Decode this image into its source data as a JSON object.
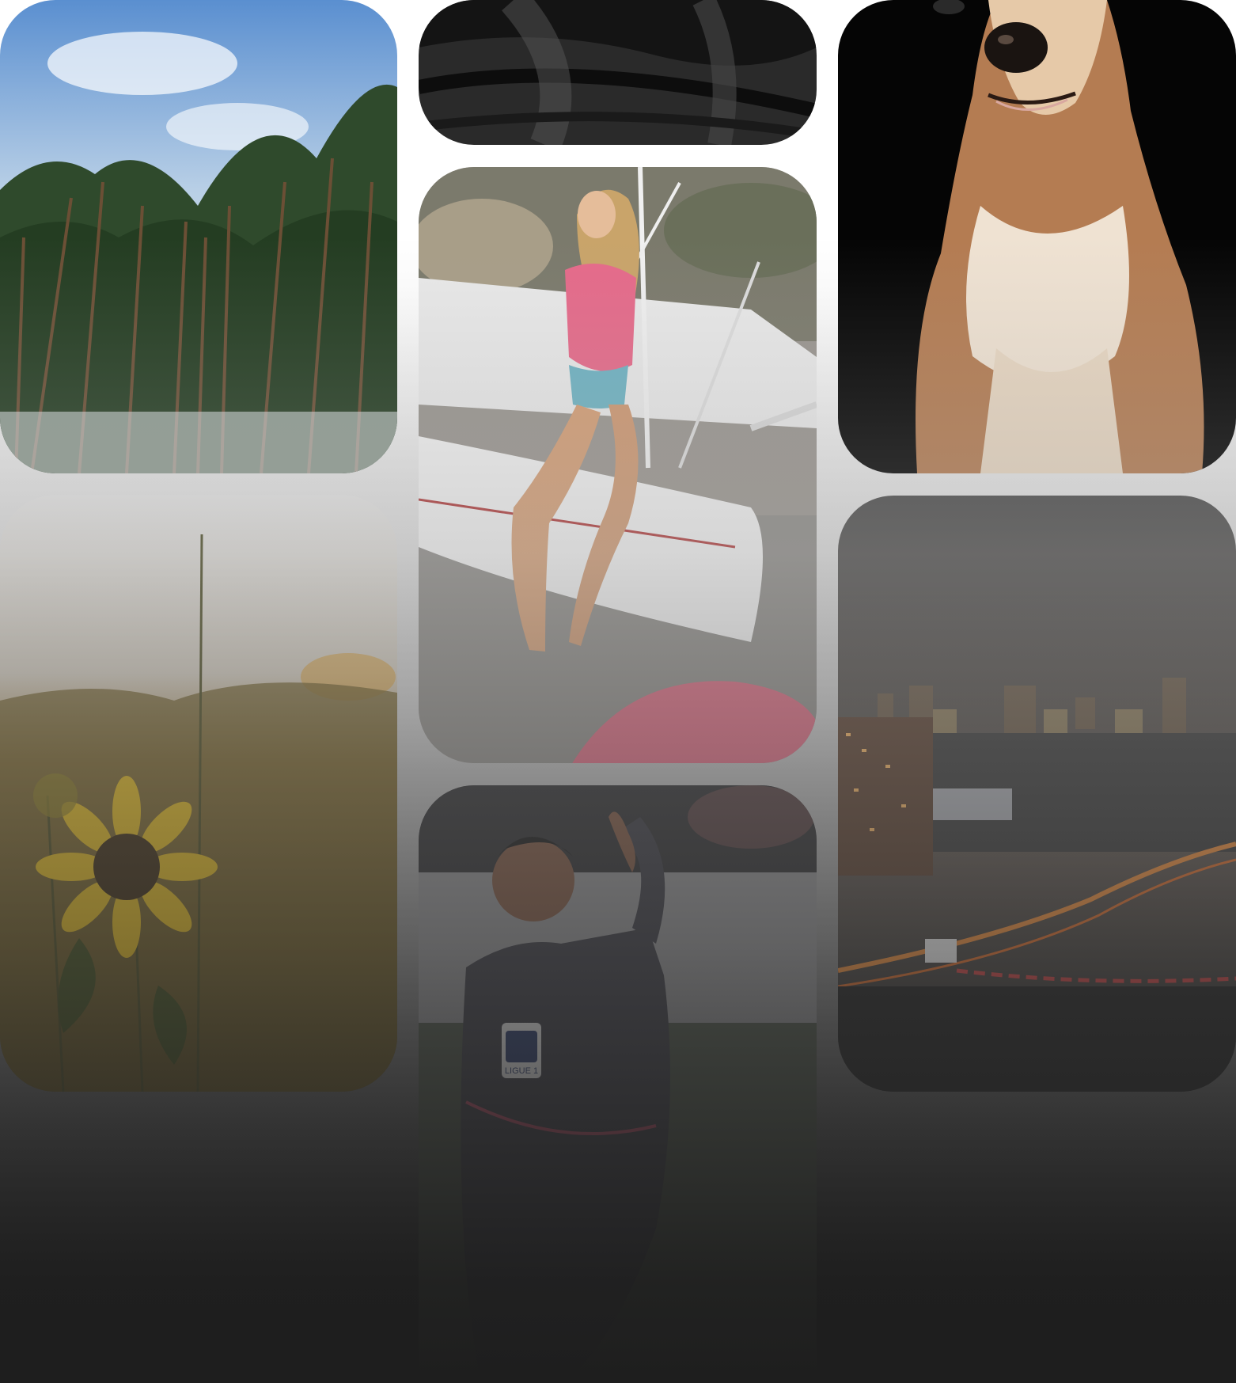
{
  "gallery": {
    "tiles": [
      {
        "id": "forest",
        "icon": "forest-photo",
        "colors": [
          "#5b8fc9",
          "#2e4a2a"
        ]
      },
      {
        "id": "sunflower",
        "icon": "sunflower-photo",
        "colors": [
          "#b9a98a",
          "#6a5a20"
        ]
      },
      {
        "id": "dark",
        "icon": "dark-abstract-photo",
        "colors": [
          "#1c1c1c",
          "#555555"
        ]
      },
      {
        "id": "boat",
        "icon": "woman-on-catamaran-photo",
        "colors": [
          "#c9c9c9",
          "#e97fa4"
        ]
      },
      {
        "id": "player",
        "icon": "football-player-photo",
        "colors": [
          "#3a3a40",
          "#6a7060"
        ]
      },
      {
        "id": "dog",
        "icon": "dog-portrait-photo",
        "colors": [
          "#000000",
          "#b7835a"
        ]
      },
      {
        "id": "city",
        "icon": "city-night-photo",
        "colors": [
          "#4a4a4a",
          "#e0a050"
        ]
      }
    ]
  },
  "player_badge": {
    "text": "LIGUE 1"
  }
}
